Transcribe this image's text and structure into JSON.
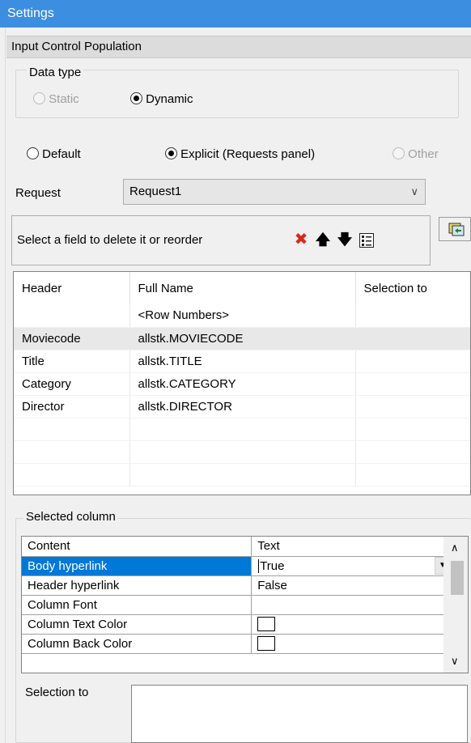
{
  "window": {
    "title": "Settings"
  },
  "section": {
    "title": "Input Control Population"
  },
  "data_type": {
    "legend": "Data type",
    "options": [
      {
        "label": "Static",
        "checked": false,
        "disabled": true
      },
      {
        "label": "Dynamic",
        "checked": true,
        "disabled": false
      }
    ]
  },
  "source": {
    "options": [
      {
        "label": "Default",
        "checked": false,
        "disabled": false
      },
      {
        "label": "Explicit (Requests panel)",
        "checked": true,
        "disabled": false
      },
      {
        "label": "Other",
        "checked": false,
        "disabled": true
      }
    ]
  },
  "request": {
    "label": "Request",
    "value": "Request1"
  },
  "fields": {
    "hint": "Select a field to delete it or reorder",
    "icons": [
      "delete-icon",
      "move-up-icon",
      "move-down-icon",
      "properties-icon",
      "copy-icon"
    ]
  },
  "grid": {
    "columns": [
      "Header",
      "Full Name",
      "Selection to"
    ],
    "rows": [
      {
        "header": "",
        "full_name": "<Row Numbers>",
        "selection_to": ""
      },
      {
        "header": "Moviecode",
        "full_name": "allstk.MOVIECODE",
        "selection_to": ""
      },
      {
        "header": "Title",
        "full_name": "allstk.TITLE",
        "selection_to": ""
      },
      {
        "header": "Category",
        "full_name": "allstk.CATEGORY",
        "selection_to": ""
      },
      {
        "header": "Director",
        "full_name": "allstk.DIRECTOR",
        "selection_to": ""
      }
    ]
  },
  "selected_column": {
    "legend": "Selected column",
    "properties": [
      {
        "key": "Content",
        "value": "Text"
      },
      {
        "key": "Body hyperlink",
        "value": "True"
      },
      {
        "key": "Header hyperlink",
        "value": "False"
      },
      {
        "key": "Column Font",
        "value": ""
      },
      {
        "key": "Column Text Color",
        "value": ""
      },
      {
        "key": "Column Back Color",
        "value": ""
      }
    ],
    "selection_to_label": "Selection to"
  },
  "colors": {
    "titlebar": "#3c8ee0",
    "selection": "#0078d7",
    "delete": "#d9291c"
  }
}
